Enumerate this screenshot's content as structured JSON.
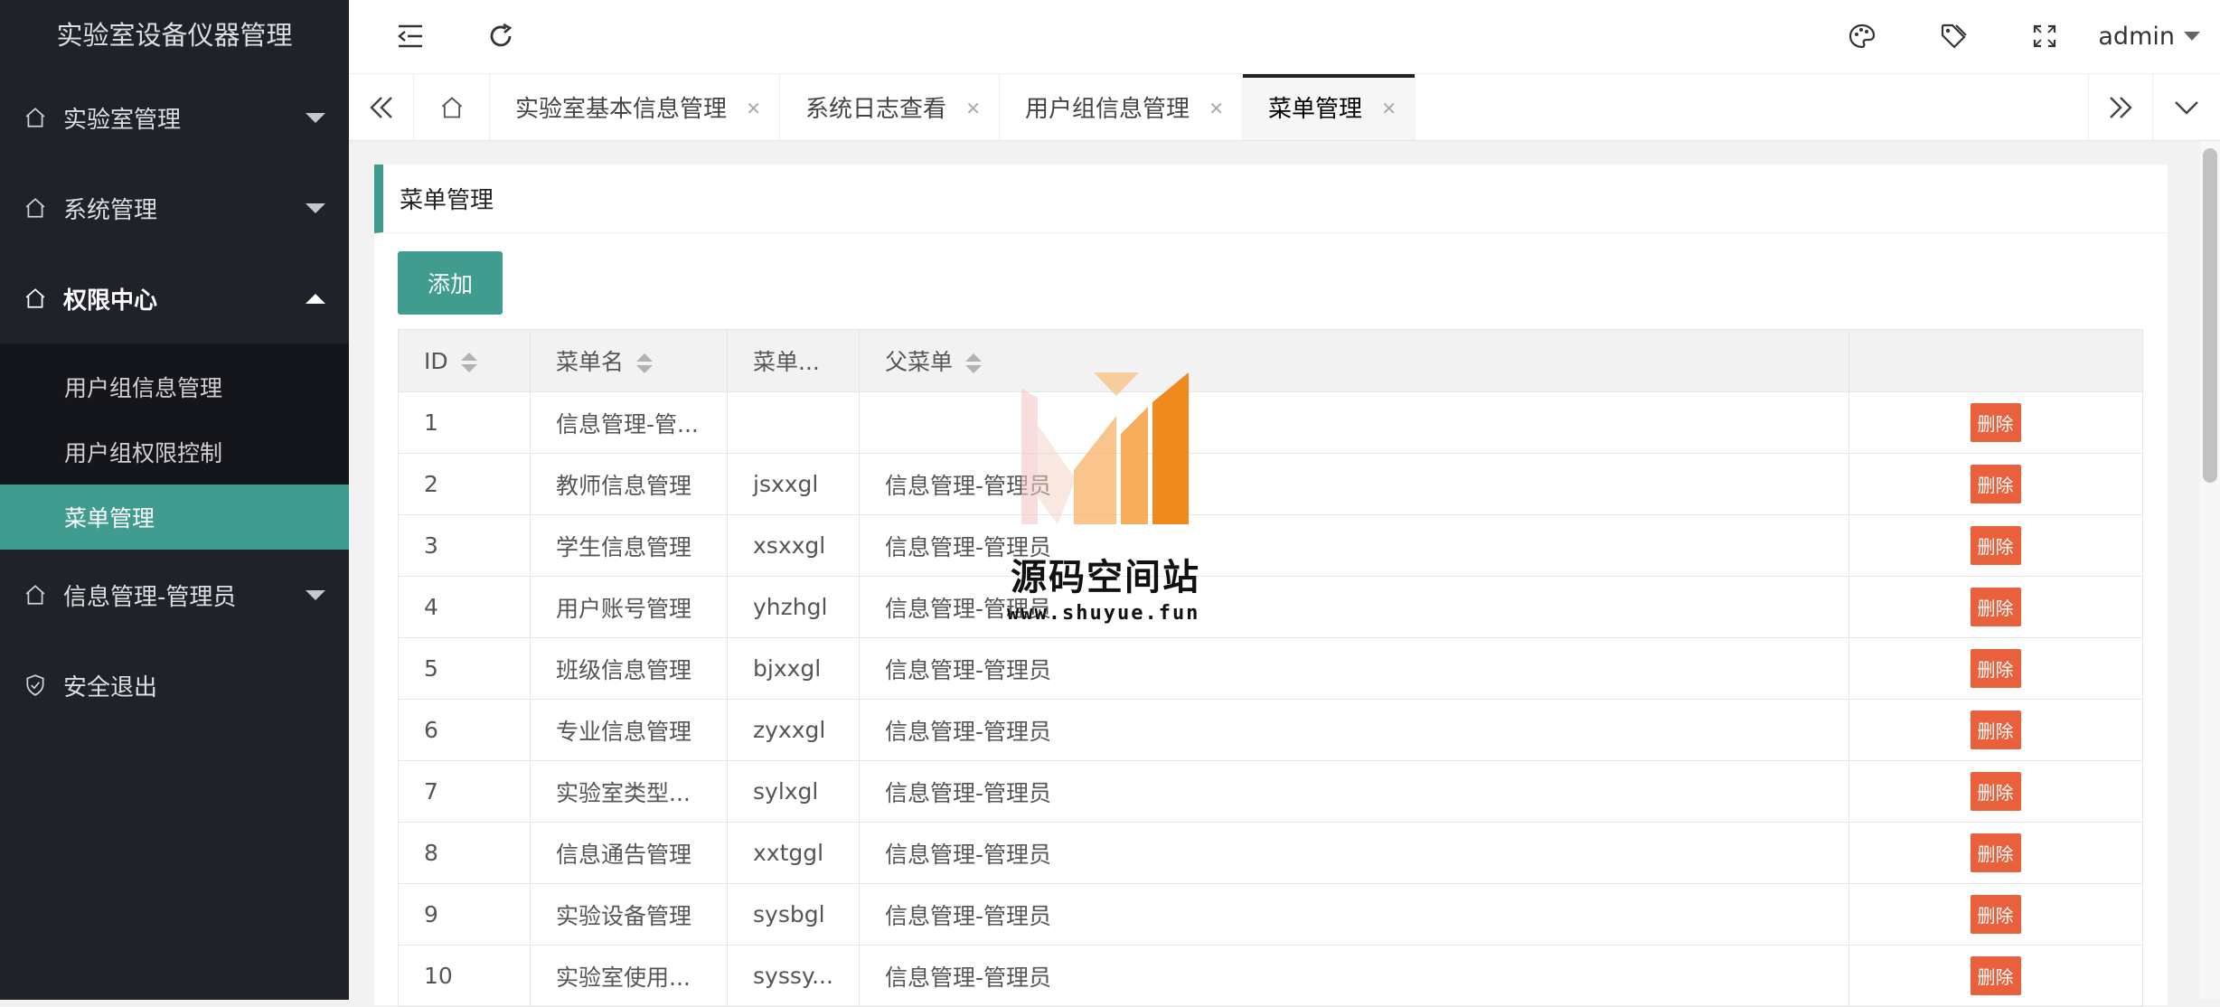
{
  "app": {
    "title": "实验室设备仪器管理"
  },
  "colors": {
    "accent": "#3f9c8f",
    "sidebar_bg": "#20222a",
    "danger": "#e8603c"
  },
  "sidebar": {
    "items": [
      {
        "label": "实验室管理",
        "icon": "home-icon",
        "expanded": false
      },
      {
        "label": "系统管理",
        "icon": "home-icon",
        "expanded": false
      },
      {
        "label": "权限中心",
        "icon": "home-icon",
        "expanded": true,
        "children": [
          {
            "label": "用户组信息管理",
            "active": false
          },
          {
            "label": "用户组权限控制",
            "active": false
          },
          {
            "label": "菜单管理",
            "active": true
          }
        ]
      },
      {
        "label": "信息管理-管理员",
        "icon": "home-icon",
        "expanded": false
      },
      {
        "label": "安全退出",
        "icon": "shield-check-icon"
      }
    ]
  },
  "header": {
    "icons": [
      "collapse-menu-icon",
      "refresh-icon",
      "theme-palette-icon",
      "tag-icon",
      "fullscreen-icon"
    ],
    "user": "admin"
  },
  "tabs": [
    {
      "label": "实验室基本信息管理"
    },
    {
      "label": "系统日志查看"
    },
    {
      "label": "用户组信息管理"
    },
    {
      "label": "菜单管理",
      "active": true
    }
  ],
  "tab_close_glyph": "✕",
  "panel": {
    "title": "菜单管理",
    "add_button": "添加",
    "columns": [
      "ID",
      "菜单名",
      "菜单...",
      "父菜单",
      ""
    ],
    "delete_label": "删除",
    "rows": [
      {
        "id": "1",
        "name": "信息管理-管...",
        "code": "",
        "parent": ""
      },
      {
        "id": "2",
        "name": "教师信息管理",
        "code": "jsxxgl",
        "parent": "信息管理-管理员"
      },
      {
        "id": "3",
        "name": "学生信息管理",
        "code": "xsxxgl",
        "parent": "信息管理-管理员"
      },
      {
        "id": "4",
        "name": "用户账号管理",
        "code": "yhzhgl",
        "parent": "信息管理-管理员"
      },
      {
        "id": "5",
        "name": "班级信息管理",
        "code": "bjxxgl",
        "parent": "信息管理-管理员"
      },
      {
        "id": "6",
        "name": "专业信息管理",
        "code": "zyxxgl",
        "parent": "信息管理-管理员"
      },
      {
        "id": "7",
        "name": "实验室类型...",
        "code": "sylxgl",
        "parent": "信息管理-管理员"
      },
      {
        "id": "8",
        "name": "信息通告管理",
        "code": "xxtggl",
        "parent": "信息管理-管理员"
      },
      {
        "id": "9",
        "name": "实验设备管理",
        "code": "sysbgl",
        "parent": "信息管理-管理员"
      },
      {
        "id": "10",
        "name": "实验室使用...",
        "code": "syssy...",
        "parent": "信息管理-管理员"
      }
    ]
  },
  "watermark": {
    "text": "源码空间站",
    "url": "www.shuyue.fun"
  }
}
